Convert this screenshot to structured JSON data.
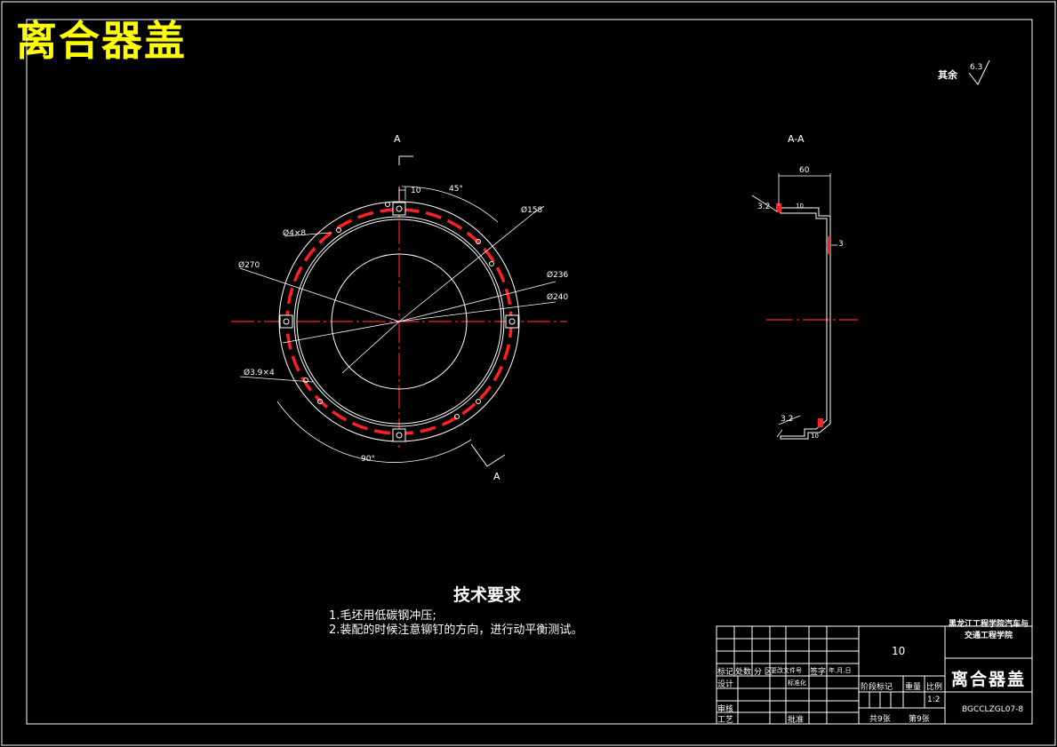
{
  "header": {
    "title": "离合器盖"
  },
  "roughness": {
    "label": "其余",
    "value": "6.3"
  },
  "front_view": {
    "section_label_top": "A",
    "section_label_bottom": "A",
    "dims": {
      "d270": "Ø270",
      "d4x8": "Ø4×8",
      "d158": "Ø158",
      "d236": "Ø236",
      "d240": "Ø240",
      "d39x4": "Ø3.9×4",
      "w10": "10",
      "a45": "45°",
      "a90": "90°"
    }
  },
  "section_view": {
    "title": "A-A",
    "dims": {
      "w60": "60",
      "t3": "3",
      "r32a": "3.2",
      "r32b": "3.2",
      "s10a": "10",
      "s10b": "10"
    }
  },
  "tech": {
    "title": "技术要求",
    "lines": [
      "1.毛坯用低碳钢冲压;",
      "2.装配的时候注意铆钉的方向，进行动平衡测试。"
    ]
  },
  "title_block": {
    "school": "黑龙江工程学院汽车与交通工程学院",
    "part_name": "离合器盖",
    "center_value": "10",
    "drawing_no": "BGCCLZGL07-8",
    "scale": "1:2",
    "labels": {
      "mark": "标记",
      "count": "处数",
      "zone": "分 区",
      "change_doc": "更改文件号",
      "sign": "签字",
      "date": "年.月.日",
      "design": "设计",
      "standard": "标准化",
      "review": "审核",
      "process": "工艺",
      "approve": "批准",
      "stage": "阶段标记",
      "weight": "重量",
      "ratio": "比例",
      "sheets_total": "共9张",
      "sheet_no": "第9张"
    }
  },
  "colors": {
    "title": "#ffff00",
    "line": "#ffffff",
    "center": "#ff0000",
    "dim": "#ffffff"
  }
}
